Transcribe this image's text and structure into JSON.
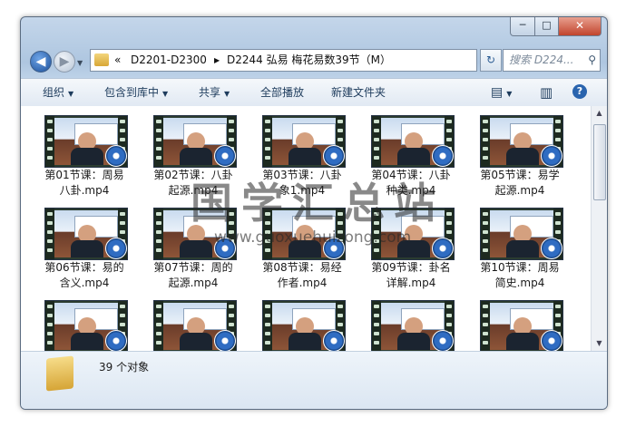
{
  "window": {
    "controls": {
      "minimize": "─",
      "maximize": "□",
      "close": "✕"
    }
  },
  "nav": {
    "back_icon": "◀",
    "forward_icon": "▶",
    "dropdown_icon": "▼",
    "breadcrumb": [
      "«",
      "D2201-D2300",
      "▶",
      "D2244 弘易 梅花易数39节（M）"
    ],
    "refresh_icon": "↻",
    "search_placeholder": "搜索 D224...",
    "search_icon": "⚲"
  },
  "toolbar": {
    "organize": "组织",
    "include_in_library": "包含到库中",
    "share": "共享",
    "play_all": "全部播放",
    "new_folder": "新建文件夹",
    "dropdown_arrow": "▼",
    "view_icon": "▤",
    "preview_pane_icon": "▥",
    "help_icon": "?"
  },
  "files": [
    {
      "line1": "第01节课：周易",
      "line2": "八卦.mp4"
    },
    {
      "line1": "第02节课：八卦",
      "line2": "起源.mp4"
    },
    {
      "line1": "第03节课：八卦",
      "line2": "象1.mp4"
    },
    {
      "line1": "第04节课：八卦",
      "line2": "种类.mp4"
    },
    {
      "line1": "第05节课：易学",
      "line2": "起源.mp4"
    },
    {
      "line1": "第06节课：易的",
      "line2": "含义.mp4"
    },
    {
      "line1": "第07节课：周的",
      "line2": "起源.mp4"
    },
    {
      "line1": "第08节课：易经",
      "line2": "作者.mp4"
    },
    {
      "line1": "第09节课：卦名",
      "line2": "详解.mp4"
    },
    {
      "line1": "第10节课：周易",
      "line2": "简史.mp4"
    },
    {
      "line1": "",
      "line2": ""
    },
    {
      "line1": "",
      "line2": ""
    },
    {
      "line1": "",
      "line2": ""
    },
    {
      "line1": "",
      "line2": ""
    },
    {
      "line1": "",
      "line2": ""
    }
  ],
  "watermark": {
    "title": "国学汇总站",
    "url": "www.guoxuehuizong.com"
  },
  "status": {
    "count": "39 个对象"
  },
  "scrollbar": {
    "up": "▲",
    "down": "▼"
  }
}
